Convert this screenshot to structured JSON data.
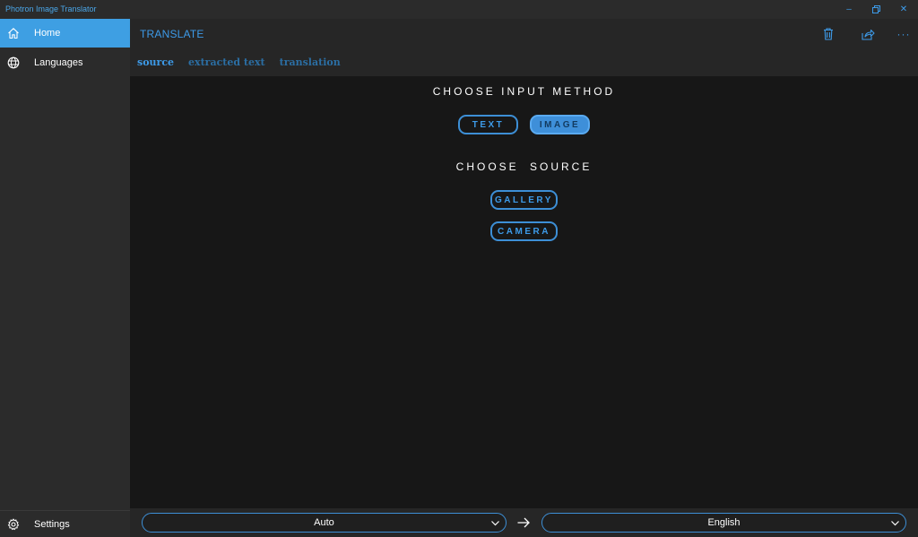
{
  "window": {
    "title": "Photron Image Translator",
    "minimize_glyph": "–",
    "close_glyph": "✕"
  },
  "sidebar": {
    "items": [
      {
        "label": "Home",
        "icon": "home-icon",
        "active": true
      },
      {
        "label": "Languages",
        "icon": "globe-icon",
        "active": false
      }
    ],
    "settings_label": "Settings"
  },
  "header": {
    "title": "TRANSLATE",
    "more_glyph": "···",
    "tabs": [
      {
        "label": "source",
        "active": true
      },
      {
        "label": "extracted text",
        "active": false
      },
      {
        "label": "translation",
        "active": false
      }
    ]
  },
  "main": {
    "input_method_title": "CHOOSE INPUT METHOD",
    "input_methods": [
      {
        "label": "TEXT",
        "selected": false
      },
      {
        "label": "IMAGE",
        "selected": true
      }
    ],
    "source_title": "CHOOSE SOURCE",
    "sources": [
      {
        "label": "GALLERY"
      },
      {
        "label": "CAMERA"
      }
    ]
  },
  "footer": {
    "source_language": "Auto",
    "target_language": "English"
  },
  "colors": {
    "accent": "#3d9be9",
    "sidebar_active": "#3e9fe3",
    "background": "#171717",
    "panel": "#2b2b2b"
  }
}
